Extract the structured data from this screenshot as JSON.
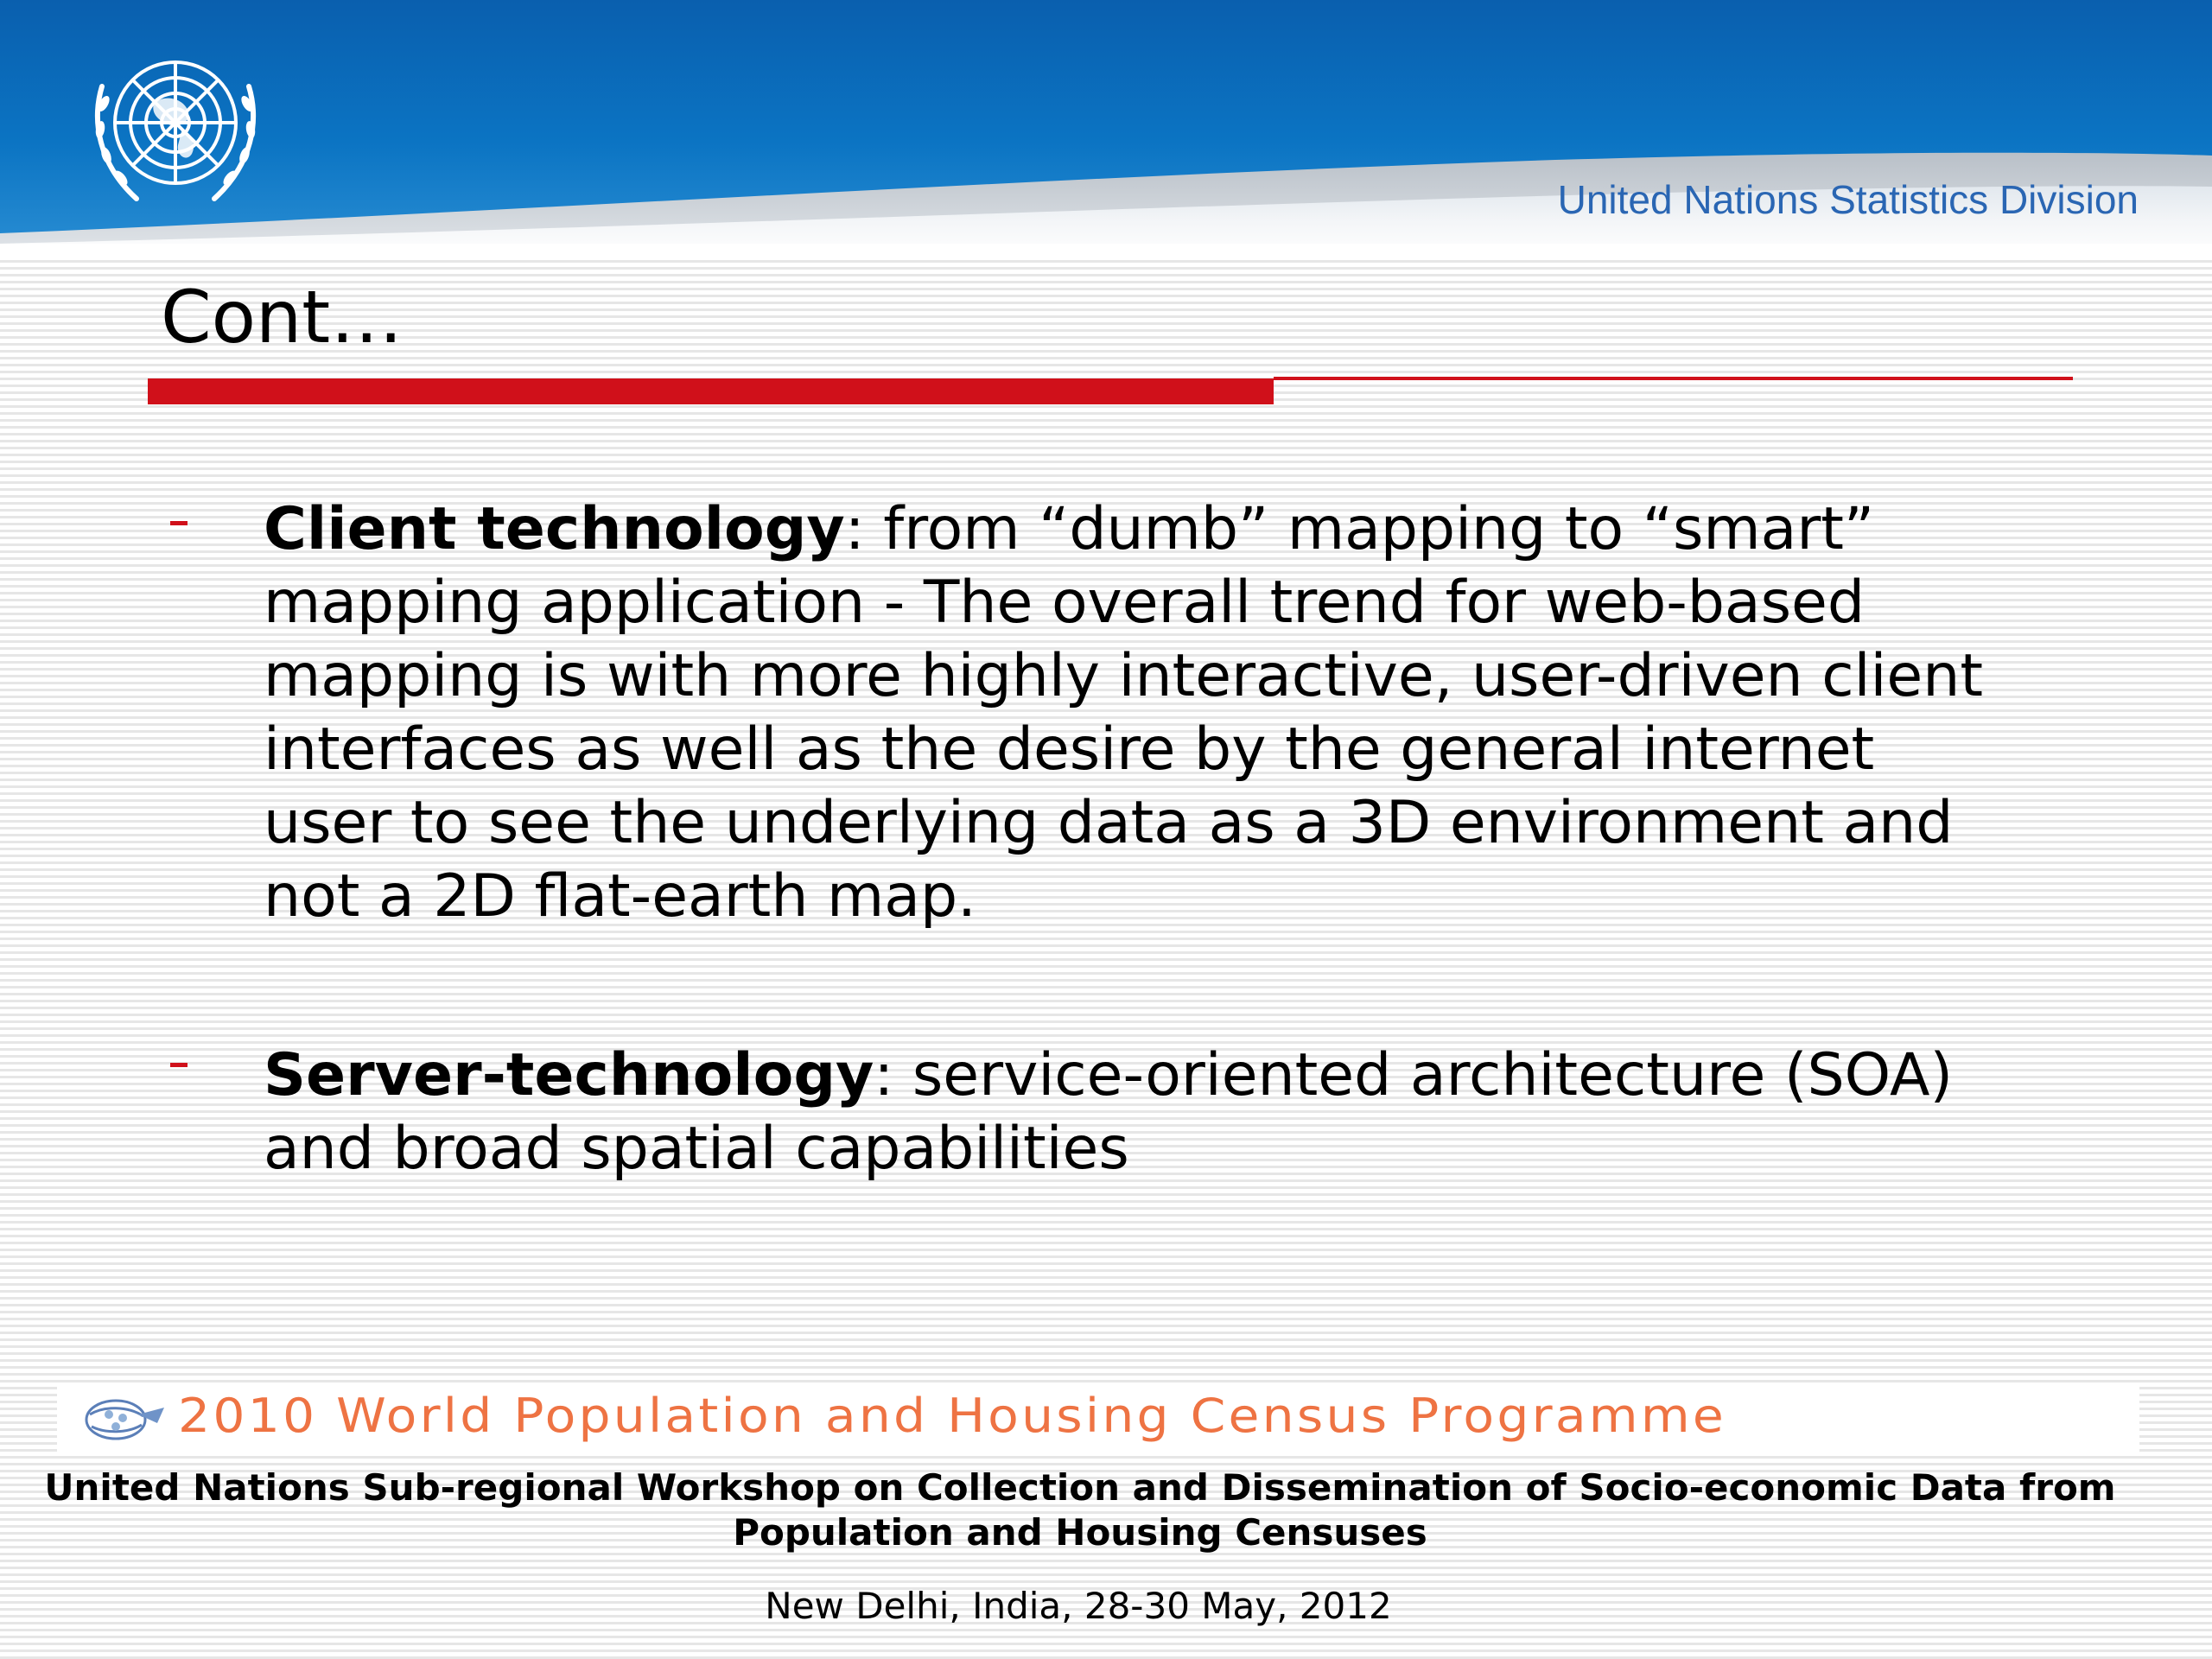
{
  "header": {
    "organization": "United Nations Statistics Division",
    "emblem_icon": "un-emblem-icon"
  },
  "slide": {
    "title": "Cont…",
    "bullets": [
      {
        "term": "Client technology",
        "text": ": from “dumb” mapping to “smart” mapping application - The overall trend for web-based mapping is with more highly interactive, user-driven client interfaces as well as the desire by the general internet user to see the underlying data as a 3D environment and not a 2D flat-earth map."
      },
      {
        "term": "Server-technology",
        "text": ": service-oriented architecture (SOA) and broad spatial capabilities"
      }
    ]
  },
  "footer": {
    "programme": "2010 World Population and Housing Census Programme",
    "programme_logo_icon": "census-programme-logo-icon",
    "workshop": "United Nations Sub-regional Workshop on Collection and Dissemination of Socio-economic Data from Population and Housing Censuses",
    "place_date": "New Delhi, India, 28-30 May, 2012"
  },
  "colors": {
    "accent_red": "#d0101a",
    "header_blue": "#0a67b4",
    "org_text_blue": "#2a66b3",
    "programme_orange": "#ee7343"
  }
}
